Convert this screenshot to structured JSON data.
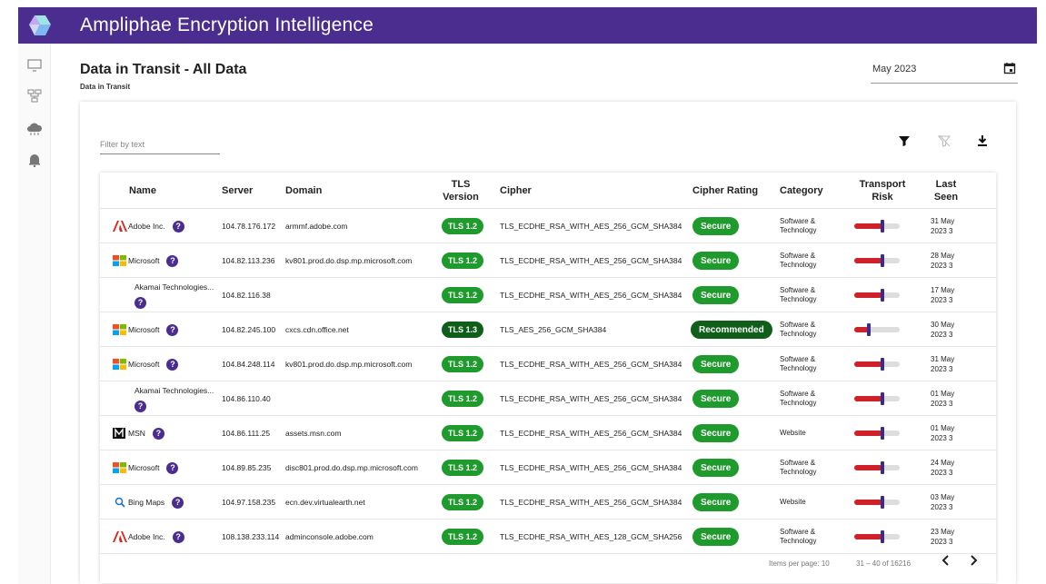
{
  "app": {
    "title": "Ampliphae Encryption Intelligence"
  },
  "page": {
    "title": "Data in Transit - All Data",
    "breadcrumb": "Data in Transit"
  },
  "date_picker": {
    "value": "May 2023"
  },
  "filter": {
    "placeholder": "Filter by text"
  },
  "table": {
    "headers": {
      "name": "Name",
      "server": "Server",
      "domain": "Domain",
      "tls_line1": "TLS",
      "tls_line2": "Version",
      "cipher": "Cipher",
      "cipher_rating": "Cipher Rating",
      "category": "Category",
      "risk_line1": "Transport",
      "risk_line2": "Risk",
      "seen_line1": "Last",
      "seen_line2": "Seen"
    },
    "rows": [
      {
        "name": "Adobe Inc.",
        "logo": "adobe",
        "server": "104.78.176.172",
        "domain": "armmf.adobe.com",
        "tls": "TLS 1.2",
        "cipher": "TLS_ECDHE_RSA_WITH_AES_256_GCM_SHA384",
        "rating": "Secure",
        "category_line1": "Software &",
        "category_line2": "Technology",
        "risk": 0.62,
        "seen_line1": "31 May",
        "seen_line2": "2023 3"
      },
      {
        "name": "Microsoft",
        "logo": "microsoft",
        "server": "104.82.113.236",
        "domain": "kv801.prod.do.dsp.mp.microsoft.com",
        "tls": "TLS 1.2",
        "cipher": "TLS_ECDHE_RSA_WITH_AES_256_GCM_SHA384",
        "rating": "Secure",
        "category_line1": "Software &",
        "category_line2": "Technology",
        "risk": 0.62,
        "seen_line1": "28 May",
        "seen_line2": "2023 3"
      },
      {
        "name": "Akamai Technologies...",
        "logo": "none",
        "server": "104.82.116.38",
        "domain": "",
        "tls": "TLS 1.2",
        "cipher": "TLS_ECDHE_RSA_WITH_AES_256_GCM_SHA384",
        "rating": "Secure",
        "category_line1": "Software &",
        "category_line2": "Technology",
        "risk": 0.62,
        "seen_line1": "17 May",
        "seen_line2": "2023 3"
      },
      {
        "name": "Microsoft",
        "logo": "microsoft",
        "server": "104.82.245.100",
        "domain": "cxcs.cdn.office.net",
        "tls": "TLS 1.3",
        "cipher": "TLS_AES_256_GCM_SHA384",
        "rating": "Recommended",
        "category_line1": "Software &",
        "category_line2": "Technology",
        "risk": 0.32,
        "seen_line1": "30 May",
        "seen_line2": "2023 3"
      },
      {
        "name": "Microsoft",
        "logo": "microsoft",
        "server": "104.84.248.114",
        "domain": "kv801.prod.do.dsp.mp.microsoft.com",
        "tls": "TLS 1.2",
        "cipher": "TLS_ECDHE_RSA_WITH_AES_256_GCM_SHA384",
        "rating": "Secure",
        "category_line1": "Software &",
        "category_line2": "Technology",
        "risk": 0.62,
        "seen_line1": "31 May",
        "seen_line2": "2023 3"
      },
      {
        "name": "Akamai Technologies...",
        "logo": "none",
        "server": "104.86.110.40",
        "domain": "",
        "tls": "TLS 1.2",
        "cipher": "TLS_ECDHE_RSA_WITH_AES_256_GCM_SHA384",
        "rating": "Secure",
        "category_line1": "Software &",
        "category_line2": "Technology",
        "risk": 0.62,
        "seen_line1": "01 May",
        "seen_line2": "2023 3"
      },
      {
        "name": "MSN",
        "logo": "msn",
        "server": "104.86.111.25",
        "domain": "assets.msn.com",
        "tls": "TLS 1.2",
        "cipher": "TLS_ECDHE_RSA_WITH_AES_256_GCM_SHA384",
        "rating": "Secure",
        "category_line1": "Website",
        "category_line2": "",
        "risk": 0.62,
        "seen_line1": "01 May",
        "seen_line2": "2023 3"
      },
      {
        "name": "Microsoft",
        "logo": "microsoft",
        "server": "104.89.85.235",
        "domain": "disc801.prod.do.dsp.mp.microsoft.com",
        "tls": "TLS 1.2",
        "cipher": "TLS_ECDHE_RSA_WITH_AES_256_GCM_SHA384",
        "rating": "Secure",
        "category_line1": "Software &",
        "category_line2": "Technology",
        "risk": 0.62,
        "seen_line1": "24 May",
        "seen_line2": "2023 3"
      },
      {
        "name": "Bing Maps",
        "logo": "bing",
        "server": "104.97.158.235",
        "domain": "ecn.dev.virtualearth.net",
        "tls": "TLS 1.2",
        "cipher": "TLS_ECDHE_RSA_WITH_AES_256_GCM_SHA384",
        "rating": "Secure",
        "category_line1": "Website",
        "category_line2": "",
        "risk": 0.62,
        "seen_line1": "03 May",
        "seen_line2": "2023 3"
      },
      {
        "name": "Adobe Inc.",
        "logo": "adobe",
        "server": "108.138.233.114",
        "domain": "adminconsole.adobe.com",
        "tls": "TLS 1.2",
        "cipher": "TLS_ECDHE_RSA_WITH_AES_128_GCM_SHA256",
        "rating": "Secure",
        "category_line1": "Software &",
        "category_line2": "Technology",
        "risk": 0.62,
        "seen_line1": "23 May",
        "seen_line2": "2023 3"
      }
    ]
  },
  "pagination": {
    "items_per_page_label": "Items per page:",
    "items_per_page": "10",
    "range": "31 – 40 of 16216"
  },
  "help_glyph": "?",
  "colors": {
    "header": "#4a2d8f",
    "secure": "#1f9b2e",
    "recommended": "#0f5e1a",
    "risk": "#d0202a",
    "risk_thumb": "#3d2b8c"
  },
  "icons": {
    "sidebar": [
      "monitor-icon",
      "network-icon",
      "cloud-icon",
      "bell-icon"
    ],
    "toolbar": [
      "filter-icon",
      "clear-filter-icon",
      "download-icon"
    ]
  }
}
